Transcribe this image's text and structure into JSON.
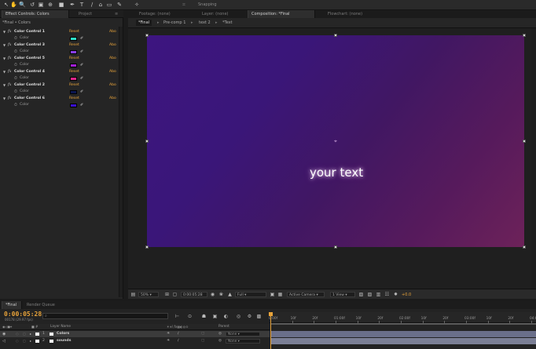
{
  "toolbar": {
    "tools": [
      "selection-tool",
      "hand-tool",
      "zoom-tool",
      "rotation-tool",
      "camera-tool",
      "pan-behind-tool",
      "rectangle-tool",
      "pen-tool",
      "type-tool",
      "brush-tool",
      "clone-stamp-tool",
      "eraser-tool",
      "roto-brush-tool",
      "puppet-pin-tool"
    ],
    "snapping_label": "Snapping"
  },
  "left_panel": {
    "tabs": [
      {
        "label": "Effect Controls: Colors",
        "active": true
      },
      {
        "label": "Project",
        "active": false
      }
    ],
    "breadcrumb": "*Final • Colors",
    "effects": [
      {
        "name": "Color Control 1",
        "reset": "Reset",
        "about": "Abo",
        "prop": "Color",
        "color": "#2fe0c8"
      },
      {
        "name": "Color Control 3",
        "reset": "Reset",
        "about": "Abo",
        "prop": "Color",
        "color": "#8a3ee8"
      },
      {
        "name": "Color Control 5",
        "reset": "Reset",
        "about": "Abo",
        "prop": "Color",
        "color": "#a21fd8"
      },
      {
        "name": "Color Control 4",
        "reset": "Reset",
        "about": "Abo",
        "prop": "Color",
        "color": "#e0258a"
      },
      {
        "name": "Color Control 2",
        "reset": "Reset",
        "about": "Abo",
        "prop": "Color",
        "color": "#0b1650"
      },
      {
        "name": "Color Control 6",
        "reset": "Reset",
        "about": "Abo",
        "prop": "Color",
        "color": "#3a10d0"
      }
    ]
  },
  "right_panel": {
    "tabs": [
      {
        "label": "Footage: (none)",
        "active": false
      },
      {
        "label": "Layer: (none)",
        "active": false
      },
      {
        "label": "Composition: *Final",
        "active": true
      },
      {
        "label": "Flowchart: (none)",
        "active": false
      }
    ],
    "breadcrumbs": [
      "*Final",
      "Pre-comp 1",
      "text 2",
      "*Text"
    ],
    "comp_text": "your text",
    "viewer_bar": {
      "zoom": "50%",
      "timecode": "0:00:05:28",
      "resolution": "Full",
      "camera": "Active Camera",
      "views": "1 View",
      "exposure": "+0.0"
    }
  },
  "timeline": {
    "tabs": [
      {
        "label": "*Final",
        "active": true
      },
      {
        "label": "Render Queue",
        "active": false
      }
    ],
    "current_time": "0:00:05:28",
    "fps_info": "00178 (29.97 fps)",
    "search_placeholder": "",
    "header": {
      "layer_name": "Layer Name",
      "parent": "Parent"
    },
    "layers": [
      {
        "index": "1",
        "name": "Colors",
        "parent": "None",
        "selected": true,
        "label_color": "#ffffff",
        "bar_color": "#6a6f8a"
      },
      {
        "index": "2",
        "name": "sounds",
        "parent": "None",
        "selected": false,
        "label_color": "#ffffff",
        "bar_color": "#7b7f95"
      }
    ],
    "ruler_labels": [
      "0:00f",
      "10f",
      "20f",
      "01:00f",
      "10f",
      "20f",
      "02:00f",
      "10f",
      "20f",
      "03:00f",
      "10f",
      "20f",
      "04:00f"
    ]
  },
  "colors": {
    "accent_orange": "#e8a33a",
    "panel_bg": "#252525",
    "comp_gradient_start": "#3d1580",
    "comp_gradient_end": "#6d2259"
  }
}
